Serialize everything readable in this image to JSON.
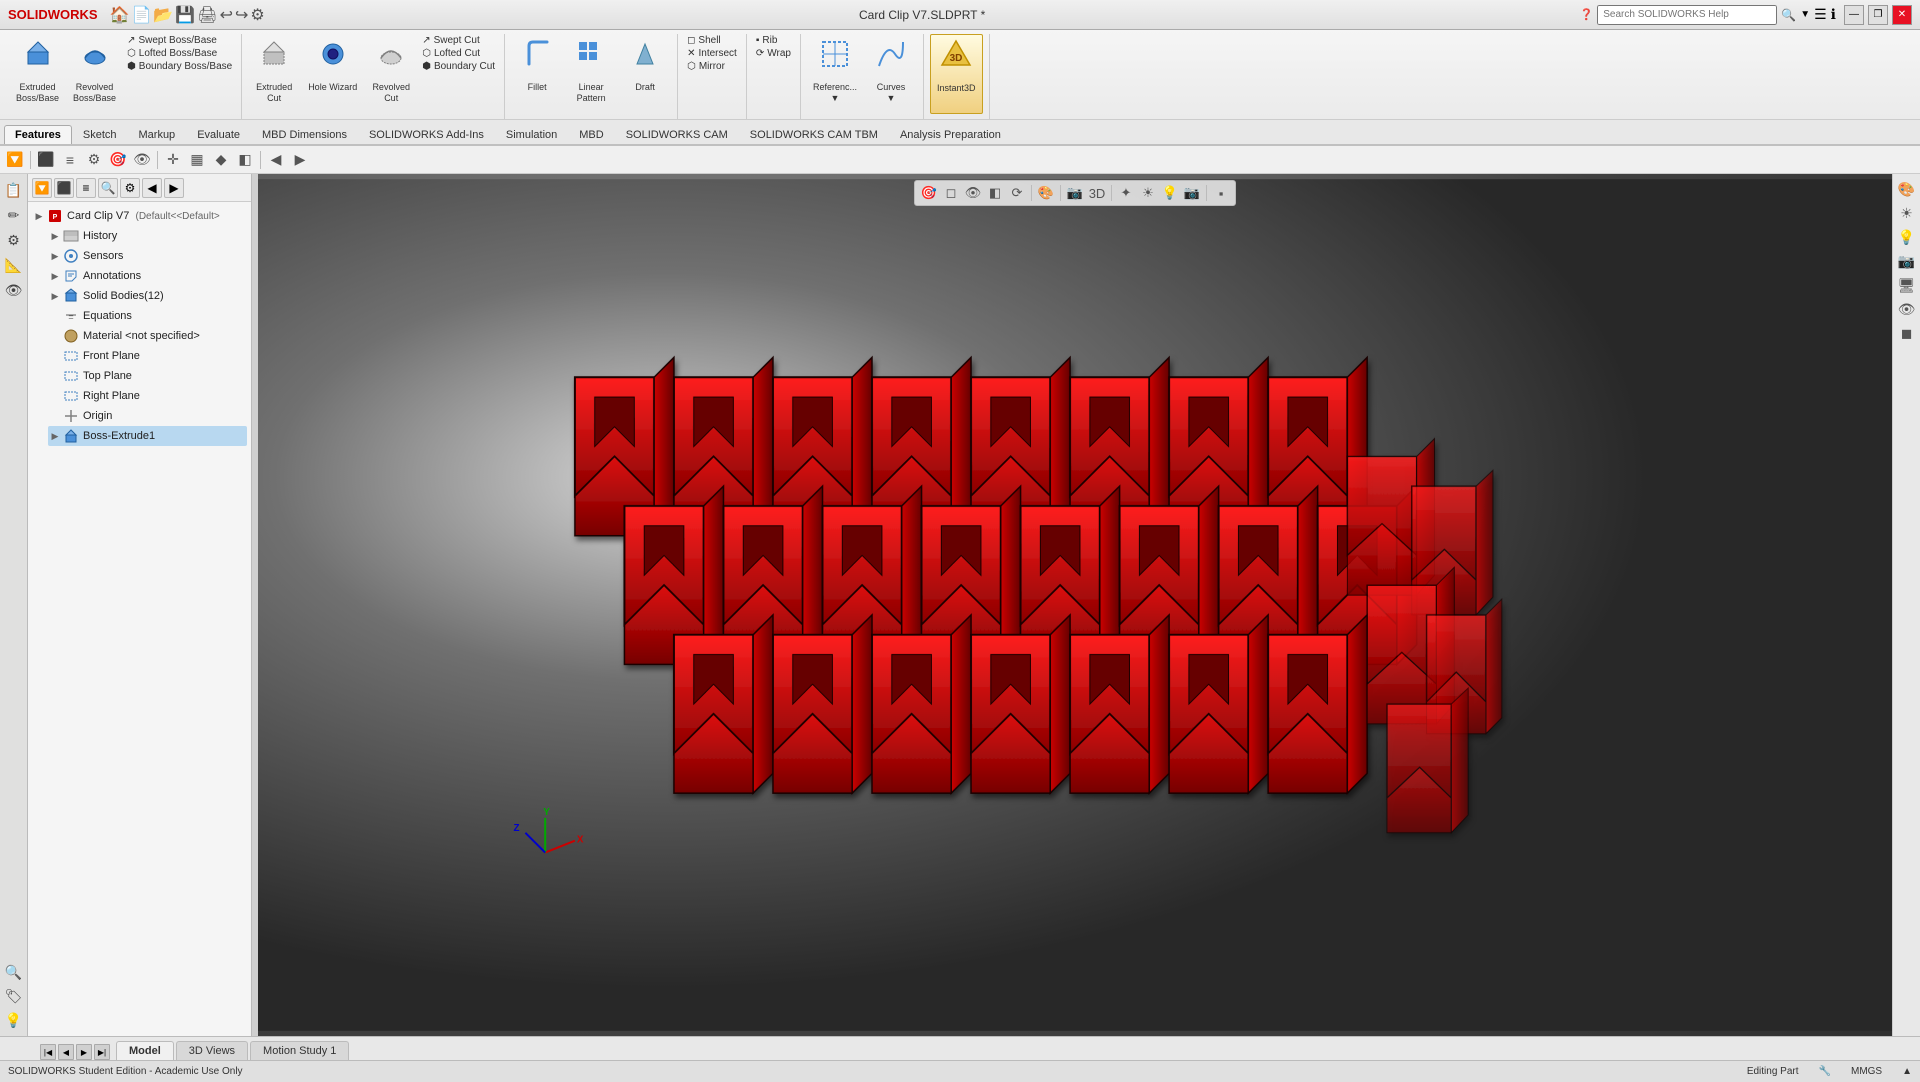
{
  "titlebar": {
    "app_name": "SOLIDWORKS",
    "document_title": "Card Clip V7.SLDPRT *",
    "search_placeholder": "Search SOLIDWORKS Help",
    "minimize_label": "—",
    "restore_label": "❐",
    "close_label": "✕"
  },
  "ribbon": {
    "groups": [
      {
        "name": "boss_base_group",
        "items": [
          {
            "id": "extruded-boss",
            "label": "Extruded\nBoss/Base",
            "icon": "⬛"
          },
          {
            "id": "revolved-boss",
            "label": "Revolved\nBoss/Base",
            "icon": "🔄"
          }
        ],
        "sub_items": [
          {
            "id": "swept-boss",
            "label": "Swept Boss/Base",
            "icon": "↗"
          },
          {
            "id": "lofted-boss",
            "label": "Lofted Boss/Base",
            "icon": "⬡"
          },
          {
            "id": "boundary-boss",
            "label": "Boundary Boss/Base",
            "icon": "⬢"
          }
        ]
      },
      {
        "name": "cut_group",
        "items": [
          {
            "id": "extruded-cut",
            "label": "Extruded\nCut",
            "icon": "⬜"
          },
          {
            "id": "hole-wizard",
            "label": "Hole Wizard",
            "icon": "⭕"
          },
          {
            "id": "revolved-cut",
            "label": "Revolved\nCut",
            "icon": "🔁"
          }
        ],
        "sub_items": [
          {
            "id": "swept-cut",
            "label": "Swept Cut",
            "icon": "↗"
          },
          {
            "id": "lofted-cut",
            "label": "Lofted Cut",
            "icon": "⬡"
          },
          {
            "id": "boundary-cut",
            "label": "Boundary Cut",
            "icon": "⬢"
          }
        ]
      },
      {
        "name": "features_group",
        "items": [
          {
            "id": "fillet",
            "label": "Fillet",
            "icon": "◼"
          },
          {
            "id": "linear-pattern",
            "label": "Linear\nPattern",
            "icon": "⬛"
          },
          {
            "id": "draft",
            "label": "Draft",
            "icon": "◧"
          }
        ]
      },
      {
        "name": "shell_intersect_group",
        "items": [
          {
            "id": "shell",
            "label": "Shell",
            "icon": "◻"
          },
          {
            "id": "intersect",
            "label": "Intersect",
            "icon": "✕"
          },
          {
            "id": "mirror",
            "label": "Mirror",
            "icon": "⬡"
          }
        ]
      },
      {
        "name": "references_group",
        "items": [
          {
            "id": "reference-geometry",
            "label": "Referenc...",
            "icon": "📐"
          },
          {
            "id": "curves",
            "label": "Curves",
            "icon": "〜"
          },
          {
            "id": "instant3d",
            "label": "Instant3D",
            "icon": "🔧"
          }
        ]
      },
      {
        "name": "wrap_rib_group",
        "items": [
          {
            "id": "rib",
            "label": "Rib",
            "icon": "▪"
          },
          {
            "id": "wrap",
            "label": "Wrap",
            "icon": "⟳"
          }
        ]
      }
    ],
    "tabs": [
      {
        "id": "features-tab",
        "label": "Features",
        "active": true
      },
      {
        "id": "sketch-tab",
        "label": "Sketch",
        "active": false
      },
      {
        "id": "markup-tab",
        "label": "Markup",
        "active": false
      },
      {
        "id": "evaluate-tab",
        "label": "Evaluate",
        "active": false
      },
      {
        "id": "mbd-dimensions-tab",
        "label": "MBD Dimensions",
        "active": false
      },
      {
        "id": "solidworks-addins-tab",
        "label": "SOLIDWORKS Add-Ins",
        "active": false
      },
      {
        "id": "simulation-tab",
        "label": "Simulation",
        "active": false
      },
      {
        "id": "mbd-tab",
        "label": "MBD",
        "active": false
      },
      {
        "id": "solidworks-cam-tab",
        "label": "SOLIDWORKS CAM",
        "active": false
      },
      {
        "id": "solidworks-cam-tbm-tab",
        "label": "SOLIDWORKS CAM TBM",
        "active": false
      },
      {
        "id": "analysis-preparation-tab",
        "label": "Analysis Preparation",
        "active": false
      }
    ]
  },
  "feature_tree": {
    "document_name": "Card Clip V7",
    "document_config": "(Default<<Default>)",
    "items": [
      {
        "id": "history",
        "label": "History",
        "icon": "📋",
        "expandable": true,
        "expanded": false,
        "level": 1
      },
      {
        "id": "sensors",
        "label": "Sensors",
        "icon": "📡",
        "expandable": true,
        "expanded": false,
        "level": 1
      },
      {
        "id": "annotations",
        "label": "Annotations",
        "icon": "✏️",
        "expandable": true,
        "expanded": false,
        "level": 1
      },
      {
        "id": "solid-bodies",
        "label": "Solid Bodies(12)",
        "icon": "📦",
        "expandable": true,
        "expanded": false,
        "level": 1
      },
      {
        "id": "equations",
        "label": "Equations",
        "icon": "📐",
        "expandable": false,
        "expanded": false,
        "level": 1
      },
      {
        "id": "material",
        "label": "Material <not specified>",
        "icon": "🔧",
        "expandable": false,
        "expanded": false,
        "level": 1
      },
      {
        "id": "front-plane",
        "label": "Front Plane",
        "icon": "📄",
        "expandable": false,
        "expanded": false,
        "level": 1
      },
      {
        "id": "top-plane",
        "label": "Top Plane",
        "icon": "📄",
        "expandable": false,
        "expanded": false,
        "level": 1
      },
      {
        "id": "right-plane",
        "label": "Right Plane",
        "icon": "📄",
        "expandable": false,
        "expanded": false,
        "level": 1
      },
      {
        "id": "origin",
        "label": "Origin",
        "icon": "✚",
        "expandable": false,
        "expanded": false,
        "level": 1
      },
      {
        "id": "boss-extrude1",
        "label": "Boss-Extrude1",
        "icon": "⬛",
        "expandable": false,
        "expanded": false,
        "level": 1,
        "selected": true
      }
    ]
  },
  "view_toolbar": {
    "buttons": [
      "🎯",
      "📐",
      "🔍",
      "↗",
      "🔄",
      "⬜",
      "📷",
      "🎨",
      "⭕",
      "🔵",
      "⬡",
      "■"
    ]
  },
  "bottom_tabs": [
    {
      "id": "model-tab",
      "label": "Model",
      "active": true
    },
    {
      "id": "3d-views-tab",
      "label": "3D Views",
      "active": false
    },
    {
      "id": "motion-study-tab",
      "label": "Motion Study 1",
      "active": false
    }
  ],
  "status_bar": {
    "left_text": "SOLIDWORKS Student Edition - Academic Use Only",
    "right_items": [
      {
        "label": "Editing Part"
      },
      {
        "label": "MMGS"
      },
      {
        "label": ""
      }
    ]
  },
  "right_panel_buttons": [
    "🔍",
    "🎨",
    "🔵",
    "🔄",
    "📐"
  ],
  "colors": {
    "accent": "#cc0000",
    "tab_active_bg": "#f5f5f5",
    "selected_tree_item": "#b8d8f0"
  }
}
